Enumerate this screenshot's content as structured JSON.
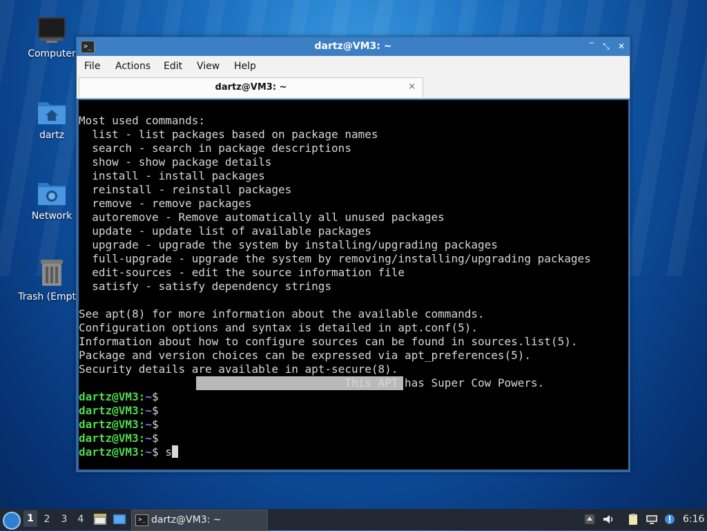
{
  "desktop": {
    "icons": [
      {
        "label": "Computer"
      },
      {
        "label": "dartz"
      },
      {
        "label": "Network"
      },
      {
        "label": "Trash (Empty)"
      }
    ]
  },
  "window": {
    "title": "dartz@VM3: ~",
    "menu": [
      "File",
      "Actions",
      "Edit",
      "View",
      "Help"
    ],
    "tab_label": "dartz@VM3: ~",
    "tab_close": "×"
  },
  "terminal": {
    "lines": [
      "Most used commands:",
      "  list - list packages based on package names",
      "  search - search in package descriptions",
      "  show - show package details",
      "  install - install packages",
      "  reinstall - reinstall packages",
      "  remove - remove packages",
      "  autoremove - Remove automatically all unused packages",
      "  update - update list of available packages",
      "  upgrade - upgrade the system by installing/upgrading packages",
      "  full-upgrade - upgrade the system by removing/installing/upgrading packages",
      "  edit-sources - edit the source information file",
      "  satisfy - satisfy dependency strings",
      "",
      "See apt(8) for more information about the available commands.",
      "Configuration options and syntax is detailed in apt.conf(5).",
      "Information about how to configure sources can be found in sources.list(5).",
      "Package and version choices can be expressed via apt_preferences(5).",
      "Security details are available in apt-secure(8).",
      "                                        This APT has Super Cow Powers."
    ],
    "prompt_user": "dartz@VM3",
    "prompt_sep": ":",
    "prompt_path": "~",
    "prompt_symbol": "$",
    "prompts": [
      "",
      "",
      "",
      "",
      " s"
    ]
  },
  "taskbar": {
    "workspaces": [
      "1",
      "2",
      "3",
      "4"
    ],
    "active_workspace": "1",
    "task_label": "dartz@VM3: ~",
    "clock": "6:16"
  }
}
